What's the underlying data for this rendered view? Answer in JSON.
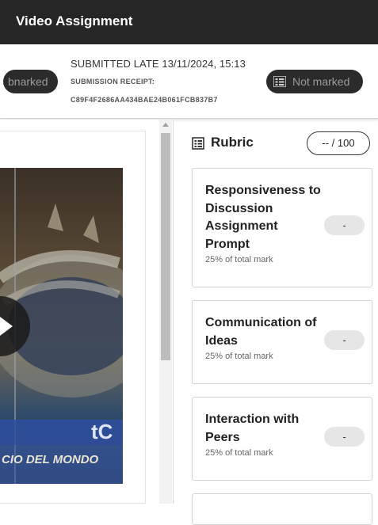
{
  "header": {
    "title": "Video Assignment"
  },
  "submission": {
    "left_badge": "bnarked",
    "status": "SUBMITTED LATE 13/11/2024, 15:13",
    "receipt_label": "SUBMISSION RECEIPT:",
    "receipt_code": "C89F4F2686AA434BAE24B061FCB837B7",
    "mark_badge": "Not marked"
  },
  "video": {
    "caption": "CIO DEL MONDO",
    "logo": "tC"
  },
  "rubric": {
    "title": "Rubric",
    "score": "-- / 100",
    "criteria": [
      {
        "name": "Responsiveness to Discussion Assignment Prompt",
        "weight": "25% of total mark",
        "mark": "-"
      },
      {
        "name": "Communication of Ideas",
        "weight": "25% of total mark",
        "mark": "-"
      },
      {
        "name": "Interaction with Peers",
        "weight": "25% of total mark",
        "mark": "-"
      }
    ]
  },
  "colors": {
    "header_bg": "#262626",
    "pill_bg": "#2b2b2b",
    "mark_bg": "#e6e6e6"
  }
}
